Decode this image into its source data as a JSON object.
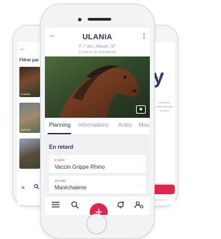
{
  "left_phone": {
    "filter_label": "Filtrer par",
    "thumb_captions": [
      "ULANIA",
      "SAPHIR",
      ""
    ]
  },
  "right_phone": {
    "logo_text": "y",
    "description": "la gestion ensemble ans un seul"
  },
  "profile": {
    "title": "ULANIA",
    "subtitle": "F, 7 ans, Alezan, SF",
    "place": "Haras de Equidecliq"
  },
  "tabs": [
    {
      "label": "Planning",
      "active": true
    },
    {
      "label": "Informations",
      "active": false
    },
    {
      "label": "Actes",
      "active": false
    },
    {
      "label": "Mou",
      "active": false
    }
  ],
  "section_title": "En retard",
  "events": [
    {
      "date": "8 JUIN",
      "name": "Vaccin Grippe Rhino"
    },
    {
      "date": "10 JUIN",
      "name": "Maréchalerie"
    }
  ],
  "bottom_nav": {
    "icons": [
      "menu-icon",
      "search-icon",
      "add-icon",
      "bell-icon",
      "user-settings-icon"
    ]
  },
  "colors": {
    "accent": "#e0254f",
    "navy": "#2c3446",
    "muted": "#8e95a2"
  }
}
